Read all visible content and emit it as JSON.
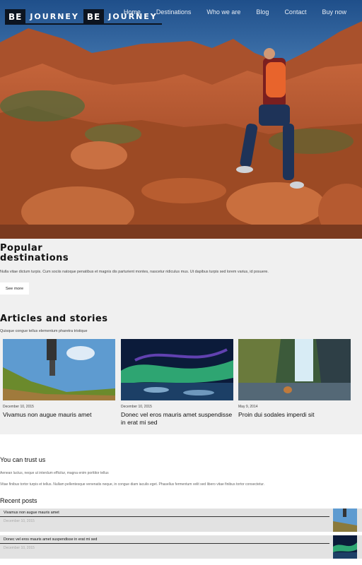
{
  "header": {
    "logo": {
      "part1": "BE",
      "part2": "JOURNEY",
      "part3": "BE",
      "part4": "JOURNEY"
    },
    "nav": [
      {
        "label": "Home",
        "active": true
      },
      {
        "label": "Destinations",
        "active": false
      },
      {
        "label": "Who we are",
        "active": false
      },
      {
        "label": "Blog",
        "active": false
      },
      {
        "label": "Contact",
        "active": false
      },
      {
        "label": "Buy now",
        "active": false
      }
    ]
  },
  "popular": {
    "title_line1": "Popular",
    "title_line2": "destinations",
    "text": "Nulla vitae dictum turpis. Cum sociis natoque penatibus et magnis dis parturient montes, nascetur ridiculus mus. Ut dapibus turpis sed lorem varius, id posuere.",
    "button_label": "See more"
  },
  "articles": {
    "title": "Articles and stories",
    "subtitle": "Quisque congue tellus elementum pharetra tristique",
    "items": [
      {
        "date": "December 10, 2015",
        "title": "Vivamus non augue mauris amet"
      },
      {
        "date": "December 10, 2015",
        "title": "Donec vel eros mauris amet suspendisse in erat mi sed"
      },
      {
        "date": "May 9, 2014",
        "title": "Proin dui sodales imperdi sit"
      }
    ]
  },
  "trust": {
    "title": "You can trust us",
    "line1": "Aenean luctus, neque ut interdum efficitur, magna enim porttitor tellus",
    "line2": "Vitae finibus tortor turpis et tellus. Nullam pellentesque venenatis neque, in congue diam iaculis eget. Phasellus fermentum velit sed libero vitae finibus tortor consectetur."
  },
  "recent": {
    "title": "Recent posts",
    "items": [
      {
        "title": "Vivamus non augue mauris amet",
        "date": "December 10, 2015"
      },
      {
        "title": "Donec vel eros mauris amet suspendisse in erat mi sed",
        "date": "December 10, 2015"
      }
    ]
  },
  "colors": {
    "dark_badge": "#0c1420",
    "section_bg": "#f0f0f0",
    "post_bg": "#e2e2e2"
  }
}
